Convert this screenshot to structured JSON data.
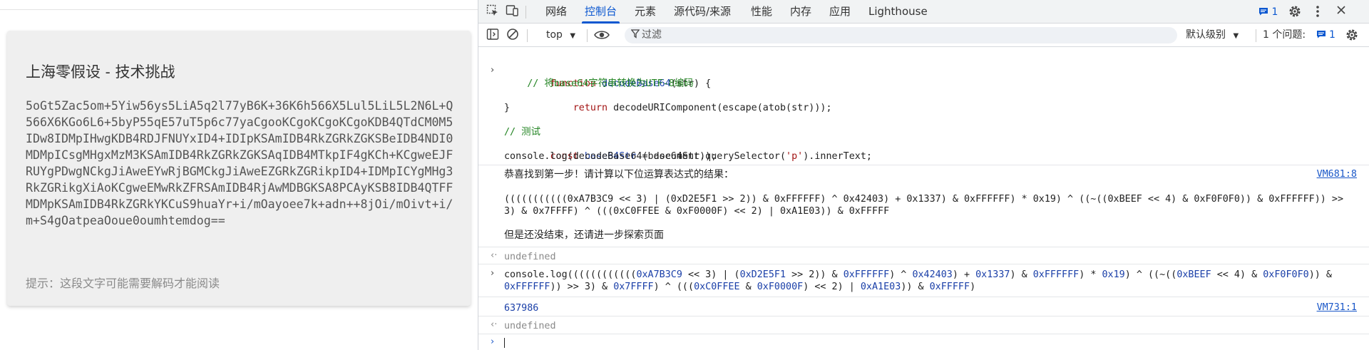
{
  "page": {
    "title": "上海零假设 - 技术挑战",
    "encoded_text": "5oGt5Zac5om+5Yiw56ys5LiA5q2l77yB6K+36K6h566X5Lul5LiL5L2N6L+Q566X6KGo6L6+5byP55qE57uT5p6c77yaCgooKCgoKCgoKCgoKDB4QTdCM0M5IDw8IDMpIHwgKDB4RDJFNUYxID4+IDIpKSAmIDB4RkZGRkZGKSBeIDB4NDI0MDMpICsgMHgxMzM3KSAmIDB4RkZGRkZGKSAqIDB4MTkpIF4gKCh+KCgweEJFRUYgPDwgNCkgJiAweEYwRjBGMCkgJiAweEZGRkZGRikpID4+IDMpICYgMHg3RkZGRikgXiAoKCgweEMwRkZFRSAmIDB4RjAwMDBGKSA8PCAyKSB8IDB4QTFFMDMpKSAmIDB4RkZGRkYKCuS9huaYr+i/mOayoee7k+adn++8jOi/mOivt+i/m+S4gOatpeaOoue0oumhtemdog==",
    "hint": "提示：这段文字可能需要解码才能阅读"
  },
  "devtools": {
    "tabs": [
      {
        "label": "网络"
      },
      {
        "label": "控制台"
      },
      {
        "label": "元素"
      },
      {
        "label": "源代码/来源"
      },
      {
        "label": "性能"
      },
      {
        "label": "内存"
      },
      {
        "label": "应用"
      },
      {
        "label": "Lighthouse"
      }
    ],
    "active_tab": "控制台",
    "issues_badge_count": "1",
    "toolbar": {
      "context": "top",
      "filter_placeholder": "过滤",
      "level": "默认级别",
      "issues_label": "1 个问题:",
      "issues_count": "1"
    },
    "console": {
      "input1": {
        "l1_kw": "function",
        "l1_fn": "decodeBase64",
        "l1_rest": "(str) {",
        "l2": "    // 将base64字符串转换为UTF-8编码",
        "l3_kw": "    return",
        "l3_rest": " decodeURIComponent(escape(atob(str)));",
        "l4": "}",
        "l6": "// 测试",
        "l7_kw": "const",
        "l7_var": " base64Str",
        "l7_mid": " = document.querySelector(",
        "l7_str": "'p'",
        "l7_end": ").innerText;",
        "l8": "console.log(decodeBase64(base64Str));"
      },
      "output1": {
        "line1": "恭喜找到第一步！请计算以下位运算表达式的结果：",
        "source": "VM681:8",
        "expr_l1": "(((((((((((0xA7B3C9 << 3) | (0xD2E5F1 >> 2)) & 0xFFFFFF) ^ 0x42403) + 0x1337) & 0xFFFFFF) * 0x19) ^ ((~((0xBEEF << 4) & 0xF0F0F0)) & 0xFFFFFF)) >>",
        "expr_l2": "3) & 0x7FFFF) ^ (((0xC0FFEE & 0xF0000F) << 2) | 0xA1E03)) & 0xFFFFF",
        "line4": "但是还没结束，还请进一步探索页面"
      },
      "undefined1": "undefined",
      "input2": {
        "l1": "console.log((((((((((((0xA7B3C9 << 3) | (0xD2E5F1 >> 2)) & 0xFFFFFF) ^ 0x42403) + 0x1337) & 0xFFFFFF) * 0x19) ^ ((~((0xBEEF << 4) & 0xF0F0F0)) &",
        "l2": "0xFFFFFF)) >> 3) & 0x7FFFF) ^ (((0xC0FFEE & 0xF0000F) << 2) | 0xA1E03)) & 0xFFFFF)"
      },
      "output2": {
        "value": "637986",
        "source": "VM731:1"
      },
      "undefined2": "undefined"
    }
  }
}
